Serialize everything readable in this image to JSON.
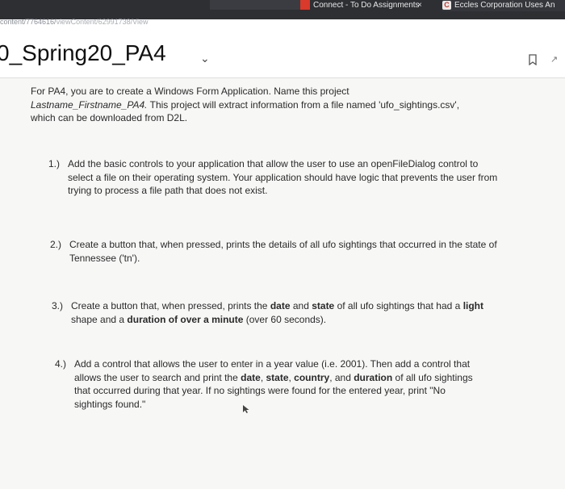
{
  "browser": {
    "tab_left": "",
    "tab_todo": "Connect - To Do Assignments",
    "tab_close": "×",
    "tab_eccles": "Eccles Corporation Uses An",
    "eccles_icon": "C",
    "url_prefix": "content/7764616/",
    "url_path": "viewContent/62991738/View"
  },
  "document": {
    "title": "0_Spring20_PA4",
    "intro_line1": "For PA4, you are to create a Windows Form Application.  Name this project",
    "intro_name": "Lastname_Firstname_PA4.",
    "intro_line2_rest": " This project will extract information from a file named 'ufo_sightings.csv',",
    "intro_line3": "which can be downloaded from D2L.",
    "items": [
      {
        "num": "1.)",
        "text": "Add the basic controls to your application that allow the user to use an openFileDialog control to select a file on their operating system.  Your application should have logic that prevents the user from trying to process a file path that does not exist."
      },
      {
        "num": "2.)",
        "text": "Create a button that, when pressed, prints the details of all ufo sightings that occurred in the state of Tennessee ('tn')."
      },
      {
        "num": "3.)",
        "text_a": "Create a button that, when pressed, prints the ",
        "b1": "date",
        "text_b": " and ",
        "b2": "state",
        "text_c": " of all ufo sightings that had a ",
        "b3": "light",
        "text_d": " shape and a ",
        "b4": "duration of over a minute",
        "text_e": " (over 60 seconds)."
      },
      {
        "num": "4.)",
        "text_a": "Add a control that allows the user to enter in a year value (i.e. 2001).  Then add a control that allows the user to search and print the ",
        "b1": "date",
        "text_b": ", ",
        "b2": "state",
        "text_c": ", ",
        "b3": "country",
        "text_d": ", and ",
        "b4": "duration",
        "text_e": " of all ufo sightings that occurred during that year.  If no sightings were found for the entered year, print \"No sightings found.\""
      }
    ]
  },
  "colors": {
    "chrome": "#2d2f33",
    "accent_red": "#d93a2b",
    "doc_bg": "#f7f7f6"
  }
}
